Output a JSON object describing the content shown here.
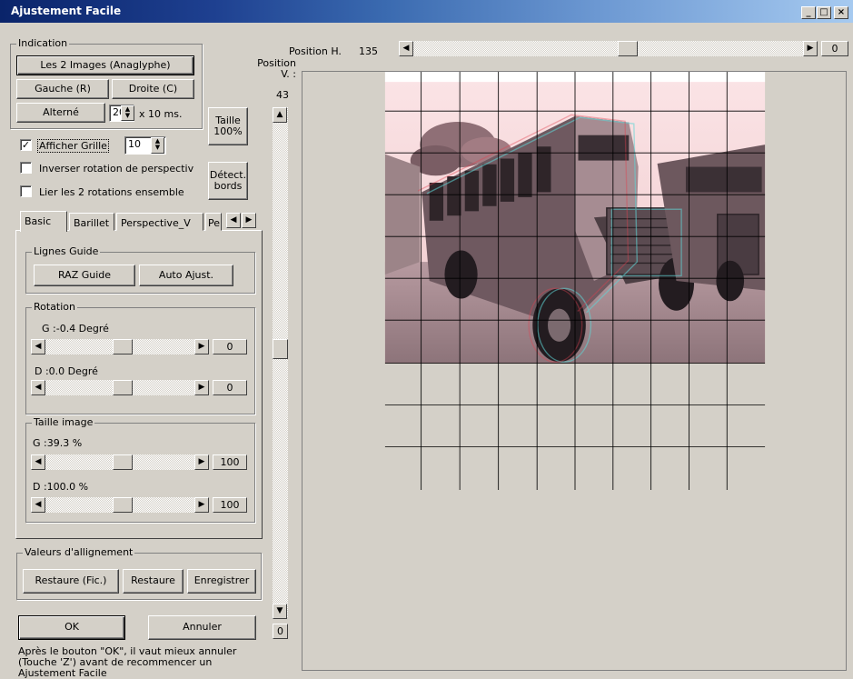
{
  "window": {
    "title": "Ajustement Facile",
    "minimize": "_",
    "maximize": "□",
    "close": "×"
  },
  "indication": {
    "label": "Indication",
    "both_images": "Les 2 Images (Anaglyphe)",
    "left": "Gauche (R)",
    "right": "Droite (C)",
    "alternate": "Alterné",
    "interval_value": "20",
    "interval_unit": "x 10 ms."
  },
  "tools": {
    "size_100": "Taille 100%",
    "detect_edges": "Détect. bords"
  },
  "options": {
    "show_grid_label": "Afficher Grille",
    "show_grid_checked": true,
    "grid_value": "10",
    "invert_rotation_label": "Inverser rotation de perspectiv",
    "invert_rotation_checked": false,
    "link_rotations_label": "Lier les 2 rotations ensemble",
    "link_rotations_checked": false
  },
  "tabs": [
    "Basic",
    "Barillet",
    "Perspective_V",
    "Pe"
  ],
  "guide_lines": {
    "label": "Lignes Guide",
    "reset": "RAZ Guide",
    "auto_adjust": "Auto Ajust."
  },
  "rotation": {
    "label": "Rotation",
    "left_text": "G :-0.4 Degré",
    "left_value": "0",
    "right_text": "D :0.0 Degré",
    "right_value": "0"
  },
  "image_size": {
    "label": "Taille image",
    "left_text": "G :39.3 %",
    "left_value": "100",
    "right_text": "D :100.0 %",
    "right_value": "100"
  },
  "alignment": {
    "label": "Valeurs d'allignement",
    "restore_file": "Restaure (Fic.)",
    "restore": "Restaure",
    "save": "Enregistrer"
  },
  "footer": {
    "ok": "OK",
    "cancel": "Annuler",
    "hint": "Après le bouton \"OK\", il vaut mieux annuler (Touche 'Z') avant de recommencer un Ajustement Facile"
  },
  "position": {
    "h_label": "Position H.",
    "h_value": "135",
    "h_reset": "0",
    "v_label": "Position V. :",
    "v_value": "43",
    "v_reset": "0"
  },
  "icons": {
    "left_arrow": "◀",
    "right_arrow": "▶",
    "up_arrow": "▲",
    "down_arrow": "▼",
    "check": "✓"
  }
}
